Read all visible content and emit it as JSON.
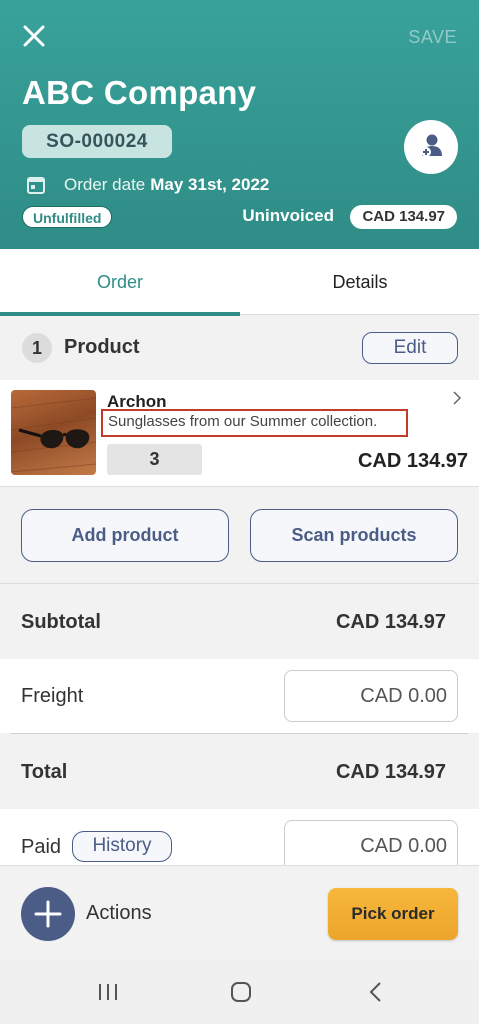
{
  "header": {
    "save_label": "SAVE",
    "company": "ABC Company",
    "order_number": "SO-000024",
    "order_date_label": "Order date",
    "order_date": "May 31st, 2022",
    "fulfillment_status": "Unfulfilled",
    "invoice_status": "Uninvoiced",
    "order_total": "CAD 134.97"
  },
  "tabs": [
    {
      "label": "Order",
      "active": true
    },
    {
      "label": "Details",
      "active": false
    }
  ],
  "products": {
    "count": "1",
    "title": "Product",
    "edit_label": "Edit",
    "items": [
      {
        "name": "Archon",
        "description": "Sunglasses from our Summer collection.",
        "quantity": "3",
        "price": "CAD 134.97"
      }
    ]
  },
  "buttons": {
    "add_product": "Add product",
    "scan_products": "Scan products"
  },
  "summary": {
    "subtotal_label": "Subtotal",
    "subtotal_value": "CAD 134.97",
    "freight_label": "Freight",
    "freight_value": "CAD 0.00",
    "total_label": "Total",
    "total_value": "CAD 134.97",
    "paid_label": "Paid",
    "history_label": "History",
    "paid_value": "CAD 0.00"
  },
  "footer": {
    "actions_label": "Actions",
    "pick_order_label": "Pick order"
  },
  "colors": {
    "header": "#2f8c86",
    "accent": "#4b5d86",
    "highlight_box": "#c23a2a",
    "pick_button": "#f0ac2f"
  }
}
